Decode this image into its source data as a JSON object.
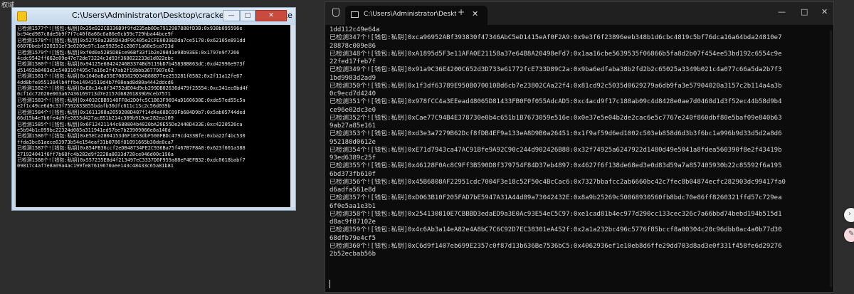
{
  "corner_label": "权域",
  "left_window": {
    "title": "C:\\Users\\Administrator\\Desktop\\cracker\\cracker_win.exe",
    "controls": {
      "minimize": "—",
      "maximize": "□",
      "close": "✕"
    },
    "lines": [
      "已检测1577个![钱包:私钥]0x35e922CB336B9f9fd235ab0De7912987888fD3B:0x938b095596e",
      "bc94ed987c8de5b9f7f7c40f8a66c6a86e0cb59c729hba44bce9f",
      "已检测1578个![钱包:私钥]0x52750a23B5D43dF9C405e2CFE0039EDda7ce5178:0x62105e891dd",
      "6607Dbebf320331ef3e0209e97c1ae9925e2c28071a68e5ca723d",
      "已检测1579个![钱包:私钥]0xf0d0a52B5D8Ece96Bf33f1b2e20841e98b93EE:0x1797e9f7266",
      "4cdc9542ff662e09e47e72de73224c3d93f368022233d1d022ebc",
      "已检测1580个![钱包:私钥]0x94125e68424246B3374Bd9119bD7b45838B863dC:0xd42996e973f",
      "d51492b8403e3c540310f495c7a16e2f47ab2f19bbb3677987e62",
      "已检测1581个![钱包:私钥]0x1640aBa55E7085829D34888B77ee253281f8582:0x2f11a12fe67",
      "4dd8bfe9551384lb4ffbe14943519d4b7f08ead8d80a4442ddcd6",
      "已检测1582个![钱包:私钥]0xE8c14c8f34752dE04d9cb299DB02636d479f25554:0xc341ec0bd4f",
      "0cf1dc72620e003a67436169713d7e2157d68261839b9ceb7571",
      "已检测1583个![钱包:私钥]0x4032CBB9148FF8d2D0fc5C1B63F9694aD160630E:0xde57ed55c5a",
      "e2f1c49ce6d9c33f7592833855bdafb30dfc611c13c2c56d039b",
      "已检测1584个![钱包:私钥]0x1611308a2059208D487f14d4a68DC09Fb684D9b7:0x5ab05744ded",
      "66d15b4e7b6fe4d9fe2855d427ac851b214c309b919ae282ea109",
      "已检测1585个![钱包:私钥]0x6F12421144c688804b4020bA20E55De2440D433E:0xc4220526ca",
      "e5b94b1c899bc22324d085a311941ed57be7b23909066e8a146d",
      "已检测1586个![钱包:私钥]0xE5ECa2804153d6F1E53dbF500FBDc479cd433Bfe:0xba22f4bc530",
      "ffda3bc61aece63973b54e154eaf31b0786f81091665b38de8ca7",
      "已检测1587个![钱包:私钥]0x854FB36ccf2eDB48734FE2C936Ba75f467B7F8A0:0x623f601a388",
      "271924041f6ff7b68fc4b282d9f2228a8033d728ce046d00c196a",
      "已检测1588个![钱包:私钥]0x557235E8d4f213497eC3337D0F959a88eF4EFB32:0xdc0618babf7",
      "09817c4af7e8a09a4ac199fe87619670aee143c48433c65a81b81"
    ]
  },
  "right_window": {
    "tab_title": "C:\\Users\\Administrator\\Desktop\\cracker\\cracker_win.exe",
    "tab_close": "✕",
    "new_tab": "+",
    "dropdown": "⌄",
    "controls": {
      "minimize": "—",
      "maximize": "□",
      "close": "✕"
    },
    "lines": [
      "1dd112c49e64a",
      "已检测347个![钱包:私钥]0xca96952ABf393830f47346AbC5eD1415eAf0F2A9:0x9e3f6f23896eeb348b1d6cbc4819c5bf76dca16a64bda24810e7",
      "28878c009e86",
      "已检测348个![钱包:私钥]0xA1895d5F3e11AFA0E21158a37e64B8A20498eFd7:0x1aa16cbe5639535f06866b5fa8d2b07f454ee53bd192c6554c9e",
      "22fed17feb7f",
      "已检测349个![钱包:私钥]0x91a9C36E4200C652d3D733e61772fcE733D89C2a:0x9ba6edfaba38b2fd2b2c65025a3349b021c4a077c66a5da2b7f3",
      "1bd9983d2ad9",
      "已检测350个![钱包:私钥]0x1f3df63789E950B070010Bd6cb7e23802CAa22f4:0x81cd92c5035d0629279a6db9fa3e57904020a3157c2b114a4a3b",
      "0c9ecd7d4240",
      "已检测351个![钱包:私钥]0x978fCC4a3EEead48065D81433FB0F0f055AdcAD5:0xc4acd9f17c188ab09c4d8428e0ae7d0468d1d3f52ec44b58d9b4",
      "ce96e02dc3e0",
      "已检测352个![钱包:私钥]0xCae77C94B4E378730e0b4c651b1B7673059e516e:0x0e37e5e04b2de2cac6e5c7767e240f860dbf80e5baf09e840b63",
      "9ab27a85e161",
      "已检测353个![钱包:私钥]0xd3e3a7279B62Dcf8fDB4EF9a133eA8D9B0a26451:0x1f9af59d6ed1002c503eb858d6d3b3f6bc1a996b9d33d5d2a8d6",
      "952180d0612e",
      "已检测354个![钱包:私钥]0xE71d7943ca47AC91Bfe9A92C90c244d902426B88:0x32f74925a6247922d1480d49e5041a8fdea560390f8e2f43419b",
      "93ed6389c25f",
      "已检测355个![钱包:私钥]0x46128F0Ac8C9Ff3B590D8f379754F84D37eb4897:0x4627f6f138de68ed3e0d83d59a7a857405930b22c85592f6a195",
      "6bd373fb610f",
      "已检测356个![钱包:私钥]0x45B6808AF22951cdc7004F3e18c52F50c4BcCac6:0x7327bbafcc2ab6660bc42c7fec8b04874ecfc282903dc99417fa0",
      "d6adfa561e8d",
      "已检测357个![钱包:私钥]0xD063B10F205FAD7bE5947A31A44d89a73042432E:0x8a9b25269c50868930560fb8bdc70e86ff8260321ffd57c729ea",
      "6f0e5aa1e3b1",
      "已检测358个![钱包:私钥]0x254130810E7CBBBD3edaED9a3E0Ac93E54eC5C97:0xe1cad81b4ec977d290cc133cec326c7a66bbd74bebd194b515d1",
      "d8ac9f87102e",
      "已检测359个![钱包:私钥]0x4c6Ab3a14eA82e4A8bC7C6C92D7EC38301eA452f:0x2a1a232bc496c5776f85bccf8a80304c20c96dbb0ac4a0b77d30",
      "68dfb79e4cf5",
      "已检测360个![钱包:私钥]0xC6d9f1407eb699E2357c0f87d13b636Be7536bC5:0x4062936ef1e10eb8d6ffe29dd703d8ad3e0f331f458fe6d29276",
      "2b52ecbab56b"
    ]
  },
  "side_buttons": {
    "first": "›",
    "second": "✎"
  }
}
